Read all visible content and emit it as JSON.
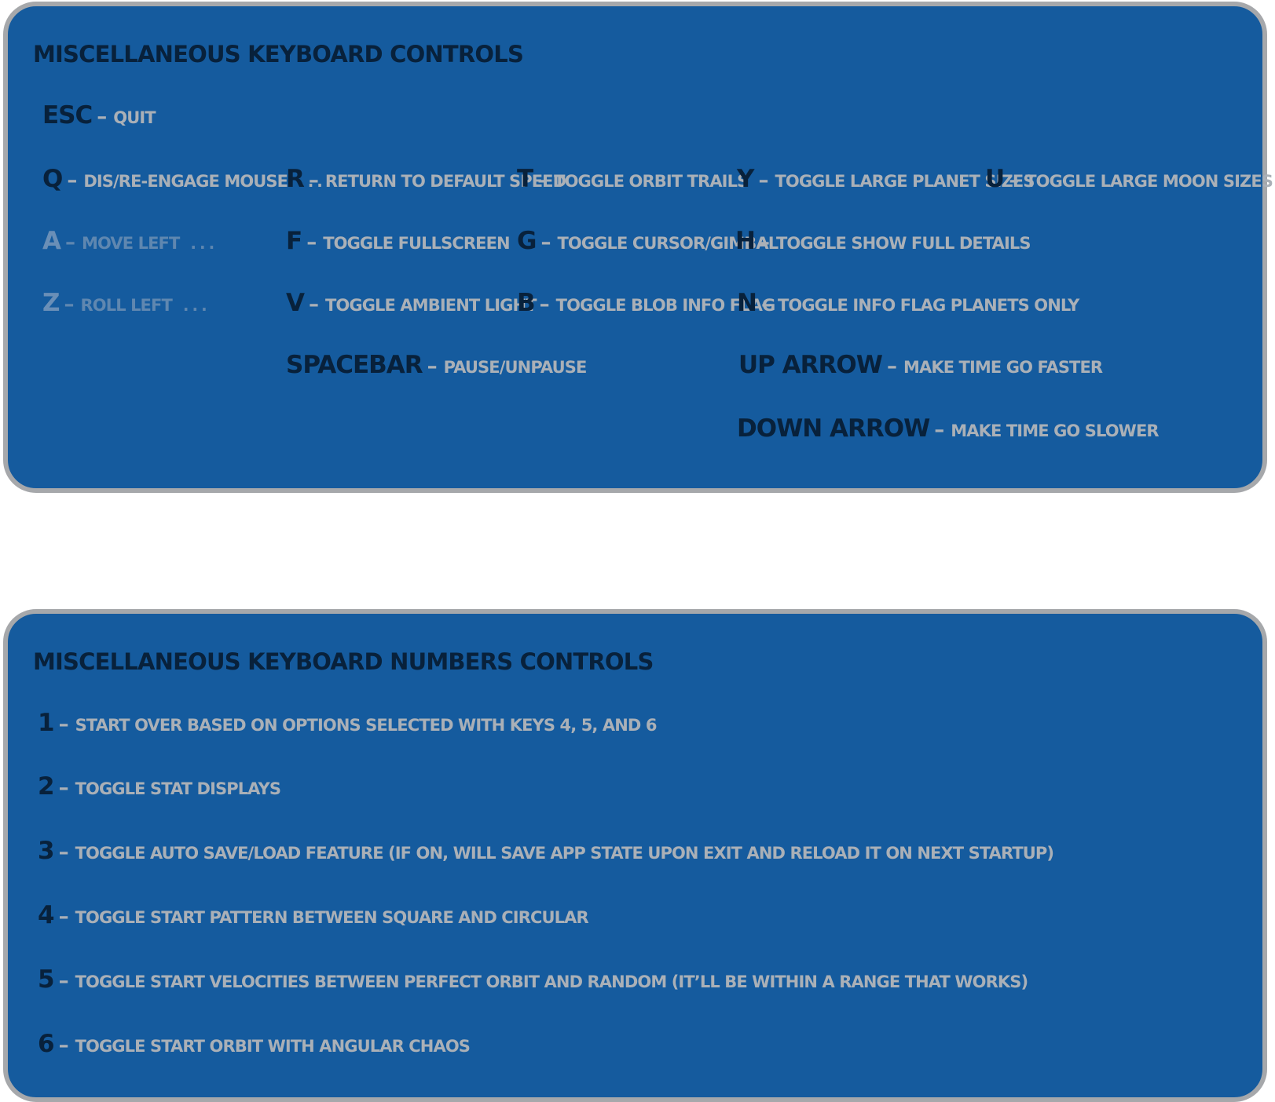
{
  "panel1": {
    "title": "Miscellaneous Keyboard Controls",
    "controls": [
      {
        "key": "ESC",
        "dash": "–",
        "desc": "Quit",
        "ellipsis": ""
      },
      {
        "key": "Q",
        "dash": "–",
        "desc": "Dis/re-engage mouse",
        "ellipsis": "..."
      },
      {
        "key": "R",
        "dash": "–",
        "desc": "Return to default speed",
        "ellipsis": ""
      },
      {
        "key": "T",
        "dash": "–",
        "desc": "Toggle orbit trails",
        "ellipsis": ""
      },
      {
        "key": "Y",
        "dash": "–",
        "desc": "Toggle large planet sizes",
        "ellipsis": ""
      },
      {
        "key": "U",
        "dash": "–",
        "desc": "Toggle large moon sizes",
        "ellipsis": ""
      },
      {
        "key": "A",
        "dash": "–",
        "desc": "Move left",
        "ellipsis": "..."
      },
      {
        "key": "F",
        "dash": "–",
        "desc": "Toggle fullscreen",
        "ellipsis": ""
      },
      {
        "key": "G",
        "dash": "–",
        "desc": "Toggle cursor/gimbal",
        "ellipsis": ""
      },
      {
        "key": "H",
        "dash": "–",
        "desc": "Toggle show full details",
        "ellipsis": ""
      },
      {
        "key": "Z",
        "dash": "–",
        "desc": "Roll left",
        "ellipsis": "..."
      },
      {
        "key": "V",
        "dash": "–",
        "desc": "Toggle ambient light",
        "ellipsis": ""
      },
      {
        "key": "B",
        "dash": "–",
        "desc": "Toggle blob info flag",
        "ellipsis": ""
      },
      {
        "key": "N",
        "dash": "–",
        "desc": "Toggle info flag planets only",
        "ellipsis": ""
      },
      {
        "key": "Spacebar",
        "dash": "–",
        "desc": "Pause/unpause",
        "ellipsis": ""
      },
      {
        "key": "Up Arrow",
        "dash": "–",
        "desc": "Make time go faster",
        "ellipsis": ""
      },
      {
        "key": "Down Arrow",
        "dash": "–",
        "desc": "Make time go slower",
        "ellipsis": ""
      }
    ]
  },
  "panel2": {
    "title": "Miscellaneous Keyboard Numbers Controls",
    "controls": [
      {
        "key": "1",
        "dash": "–",
        "desc": "Start over based on options selected with keys 4, 5, and 6",
        "ellipsis": ""
      },
      {
        "key": "2",
        "dash": "–",
        "desc": "Toggle stat displays",
        "ellipsis": ""
      },
      {
        "key": "3",
        "dash": "–",
        "desc": "Toggle auto save/load feature (if on, will save app state upon exit and reload it on next startup)",
        "ellipsis": ""
      },
      {
        "key": "4",
        "dash": "–",
        "desc": "Toggle start pattern between square and circular",
        "ellipsis": ""
      },
      {
        "key": "5",
        "dash": "–",
        "desc": "Toggle start velocities between perfect orbit and random (it’ll be within a range that works)",
        "ellipsis": ""
      },
      {
        "key": "6",
        "dash": "–",
        "desc": "Toggle start orbit with angular chaos",
        "ellipsis": ""
      }
    ]
  }
}
